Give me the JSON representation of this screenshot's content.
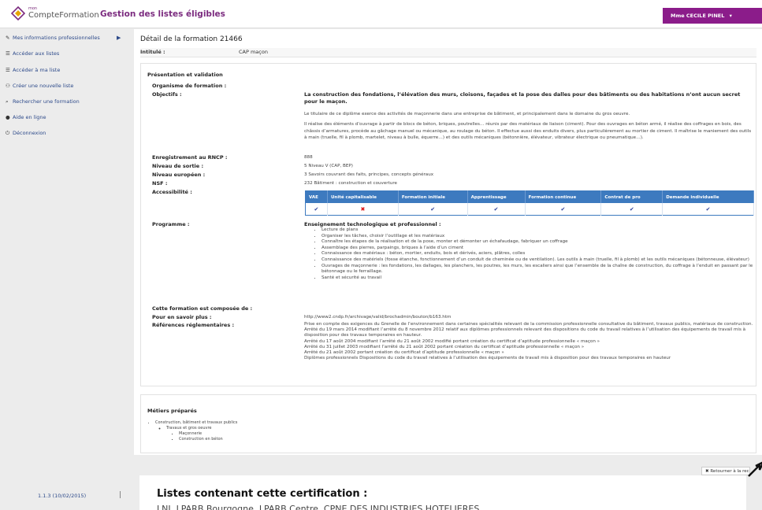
{
  "header": {
    "logo_small": "mon",
    "logo_name": "CompteFormation",
    "app_title": "Gestion des listes éligibles",
    "user": "Mme CECILE PINEL",
    "user_caret": "▾",
    "accent": "#8b1c8a"
  },
  "sidebar": {
    "items": [
      {
        "icon": "pencil-icon",
        "glyph": "✎",
        "label": "Mes informations professionnelles"
      },
      {
        "icon": "list-icon",
        "glyph": "☰",
        "label": "Accéder aux listes"
      },
      {
        "icon": "list-icon",
        "glyph": "☰",
        "label": "Accéder à ma liste"
      },
      {
        "icon": "users-icon",
        "glyph": "⚇",
        "label": "Créer une nouvelle liste"
      },
      {
        "icon": "search-icon",
        "glyph": "⌕",
        "label": "Rechercher une formation"
      },
      {
        "icon": "help-icon",
        "glyph": "●",
        "label": "Aide en ligne"
      },
      {
        "icon": "power-icon",
        "glyph": "⏻",
        "label": "Déconnexion"
      }
    ],
    "arrow": "▶",
    "version": "1.1.3 (10/02/2015)"
  },
  "detail": {
    "title": "Détail de la formation 21466",
    "intitule_label": "Intitulé :",
    "intitule_value": "CAP maçon",
    "section_title": "Présentation et validation",
    "organisme_label": "Organisme de formation :",
    "objectifs_label": "Objectifs :",
    "objectifs_title": "La construction des fondations, l’élévation des murs, cloisons, façades et la pose des dalles pour des bâtiments ou des habitations n’ont aucun secret pour le maçon.",
    "objectifs_p1": "Le titulaire de ce diplôme exerce des activités de maçonnerie dans une entreprise de bâtiment, et principalement dans le domaine du gros oeuvre.",
    "objectifs_p2": "Il réalise des éléments d’ouvrage à partir de blocs de béton, briques, poutrelles… réunis par des matériaux de liaison (ciment). Pour des ouvrages en béton armé, il réalise des coffrages en bois, des châssis d’armatures, procède au gâchage manuel ou mécanique, au roulage du béton. Il effectue aussi des enduits divers, plus particulièrement au mortier de ciment. Il maîtrise le maniement des outils à main (truelle, fil à plomb, martelet, niveau à bulle, équerre…) et des outils mécaniques (bétonnière, élévateur, vibrateur électrique ou pneumatique…).",
    "rncp_label": "Enregistrement au RNCP :",
    "rncp_value": "888",
    "niveau_label": "Niveau de sortie :",
    "niveau_value": "5 Niveau V (CAP, BEP)",
    "europeen_label": "Niveau européen :",
    "europeen_value": "3 Savoirs couvrant des faits, principes, concepts généraux",
    "nsf_label": "NSF :",
    "nsf_value": "232 Bâtiment : construction et couverture",
    "access_label": "Accessibilité :",
    "access_headers": [
      "VAE",
      "Unité capitalisable",
      "Formation initiale",
      "Apprentissage",
      "Formation continue",
      "Contrat de pro",
      "Demande individuelle"
    ],
    "access_marks": [
      "✔",
      "✖",
      "✔",
      "✔",
      "✔",
      "✔",
      "✔"
    ],
    "programme_label": "Programme :",
    "programme_title": "Enseignement technologique et professionnel :",
    "programme_items": [
      "Lecture de plans",
      "Organiser les tâches, choisir l’outillage et les matériaux",
      "Connaître les étapes de la réalisation et de la pose, monter et démonter un échafaudage, fabriquer un coffrage",
      "Assemblage des pierres, parpaings, briques à l’aide d’un ciment",
      "Connaissance des matériaux : béton, mortier, enduits, bois et dérivés, aciers, plâtres, colles",
      "Connaissance des matériels (fosse étanche, fonctionnement d’un conduit de cheminée ou de ventilation). Les outils à main (truelle, fil à plomb) et les outils mécaniques (bétonneuse, élévateur)",
      "Ouvrages de maçonnerie : les fondations, les dallages, les planchers, les poutres, les murs, les escaliers ainsi que l’ensemble de la chaîne de construction, du coffrage à l’enduit en passant par le bétonnage ou le ferraillage.",
      "Santé et sécurité au travail"
    ],
    "composee_label": "Cette formation est composée de :",
    "savoir_label": "Pour en savoir plus :",
    "savoir_value": "http://www2.cndp.fr/archivage/valid/brochadmin/bouton/b163.htm",
    "refs_label": "Références réglementaires :",
    "refs_lines": [
      "Prise en compte des exigences du Grenelle de l’environnement dans certaines spécialités relevant de la commission professionnelle consultative du bâtiment, travaux publics, matériaux de construction.",
      "Arrêté du 19 mars 2014 modifiant l’arrêté du 8 novembre 2012 relatif aux diplômes professionnels relevant des dispositions du code du travail relatives à l’utilisation des équipements de travail mis à disposition pour des travaux temporaires en hauteur.",
      "Arrêté du 17 août 2004 modifiant l’arrêté du 21 août 2002 modifié portant création du certificat d’aptitude professionnelle « maçon »",
      "Arrêté du 31 juillet 2003 modifiant l’arrêté du 21 août 2002 portant création du certificat d’aptitude professionnelle « maçon »",
      "Arrêté du 21 août 2002 portant création du certificat d’aptitude professionnelle « maçon »",
      "Diplômes professionnels Dispositions du code du travail relatives à l’utilisation des équipements de travail mis à disposition pour des travaux temporaires en hauteur"
    ]
  },
  "metiers": {
    "title": "Métiers préparés",
    "level1": "Construction, bâtiment et travaux publics",
    "level2": "Travaux et gros oeuvre",
    "level3a": "Maçonnerie",
    "level3b": "Construction en béton"
  },
  "back_button": "✖ Retourner à la recherche",
  "overlay": {
    "title": "Listes contenant cette certification :",
    "cut_line": "LNI, LPARB Bourgogne, LPARB Centre, CPNE DES INDUSTRIES HOTELIERES"
  }
}
